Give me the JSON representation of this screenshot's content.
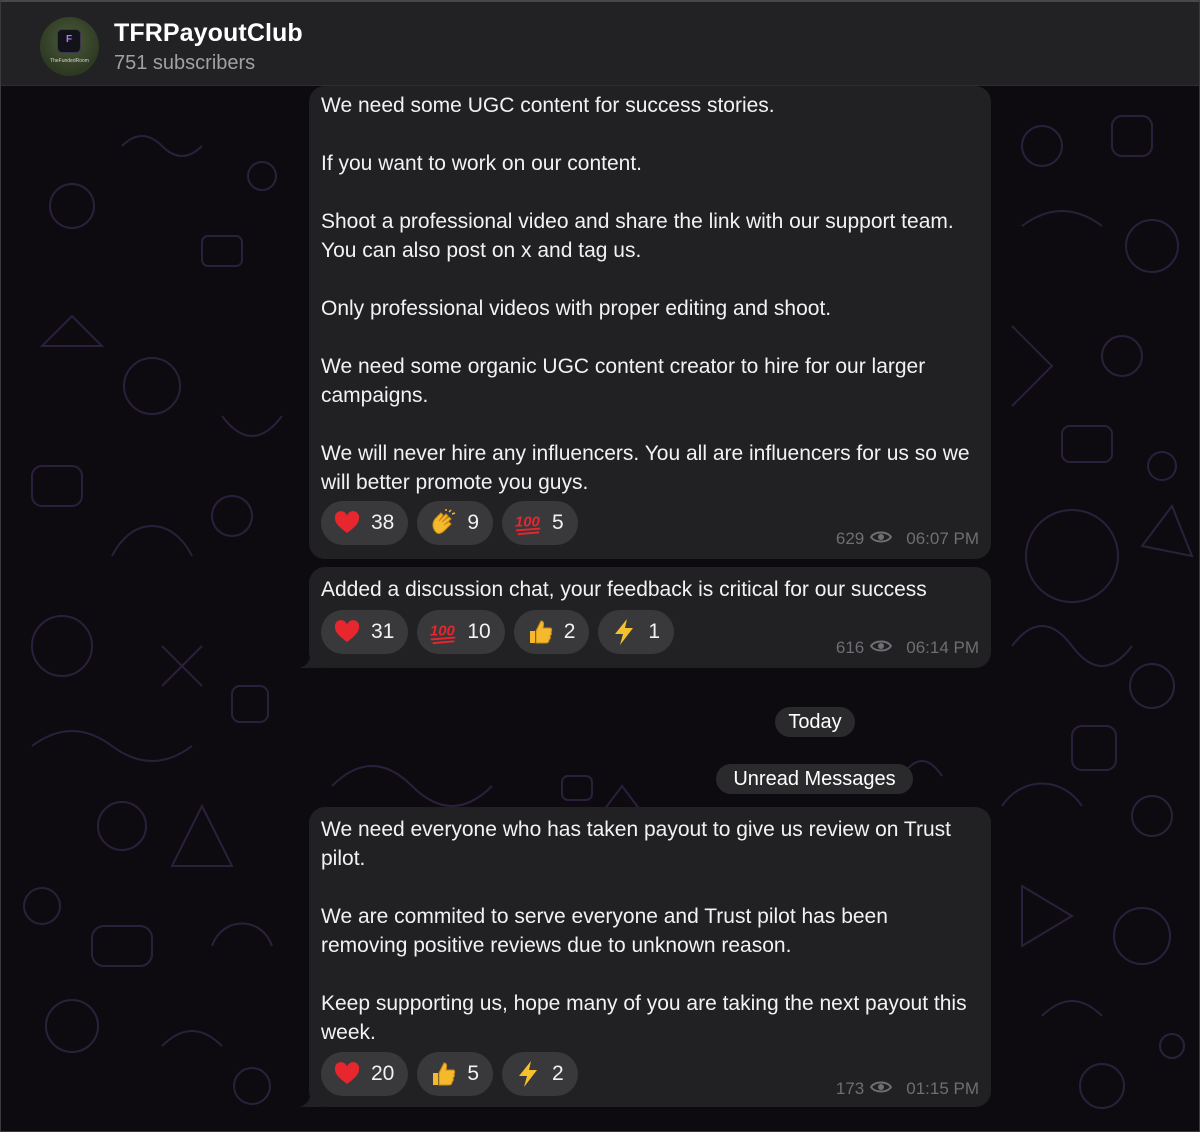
{
  "channel": {
    "name": "TFRPayoutClub",
    "subscribers": "751 subscribers",
    "avatar_caption": "TheFundedRoom",
    "avatar_letter": "F"
  },
  "messages": [
    {
      "text": "We need some UGC content for success stories.\n\nIf you want to work on our content.\n\nShoot a professional video and share the link with our support team. You can also post on x and tag us.\n\nOnly professional videos with proper editing and shoot.\n\nWe need some organic UGC content creator to hire for our larger campaigns.\n\nWe will never hire any influencers. You all are influencers for us so we will better promote you guys.",
      "reactions": [
        {
          "icon": "heart-icon",
          "count": "38"
        },
        {
          "icon": "clapping-hands-icon",
          "count": "9"
        },
        {
          "icon": "hundred-points-icon",
          "count": "5"
        }
      ],
      "views": "629",
      "time": "06:07 PM"
    },
    {
      "text": "Added a discussion chat, your feedback is critical for our success",
      "reactions": [
        {
          "icon": "heart-icon",
          "count": "31"
        },
        {
          "icon": "hundred-points-icon",
          "count": "10"
        },
        {
          "icon": "thumbs-up-icon",
          "count": "2"
        },
        {
          "icon": "lightning-icon",
          "count": "1"
        }
      ],
      "views": "616",
      "time": "06:14 PM"
    },
    {
      "text": "We need everyone who has taken payout to give us review on Trust pilot.\n\nWe are commited to serve everyone and Trust pilot has been removing positive reviews due to unknown reason.\n\nKeep supporting us, hope many of you are taking the next payout this week.",
      "reactions": [
        {
          "icon": "heart-icon",
          "count": "20"
        },
        {
          "icon": "thumbs-up-icon",
          "count": "5"
        },
        {
          "icon": "lightning-icon",
          "count": "2"
        }
      ],
      "views": "173",
      "time": "01:15 PM"
    }
  ],
  "separators": {
    "date": "Today",
    "unread": "Unread Messages"
  },
  "colors": {
    "header_bg": "#222224",
    "bubble_bg": "#212123",
    "pill_bg": "#39393c",
    "meta_text": "#6e6e73",
    "pattern_stroke": "#3a2a4a"
  }
}
